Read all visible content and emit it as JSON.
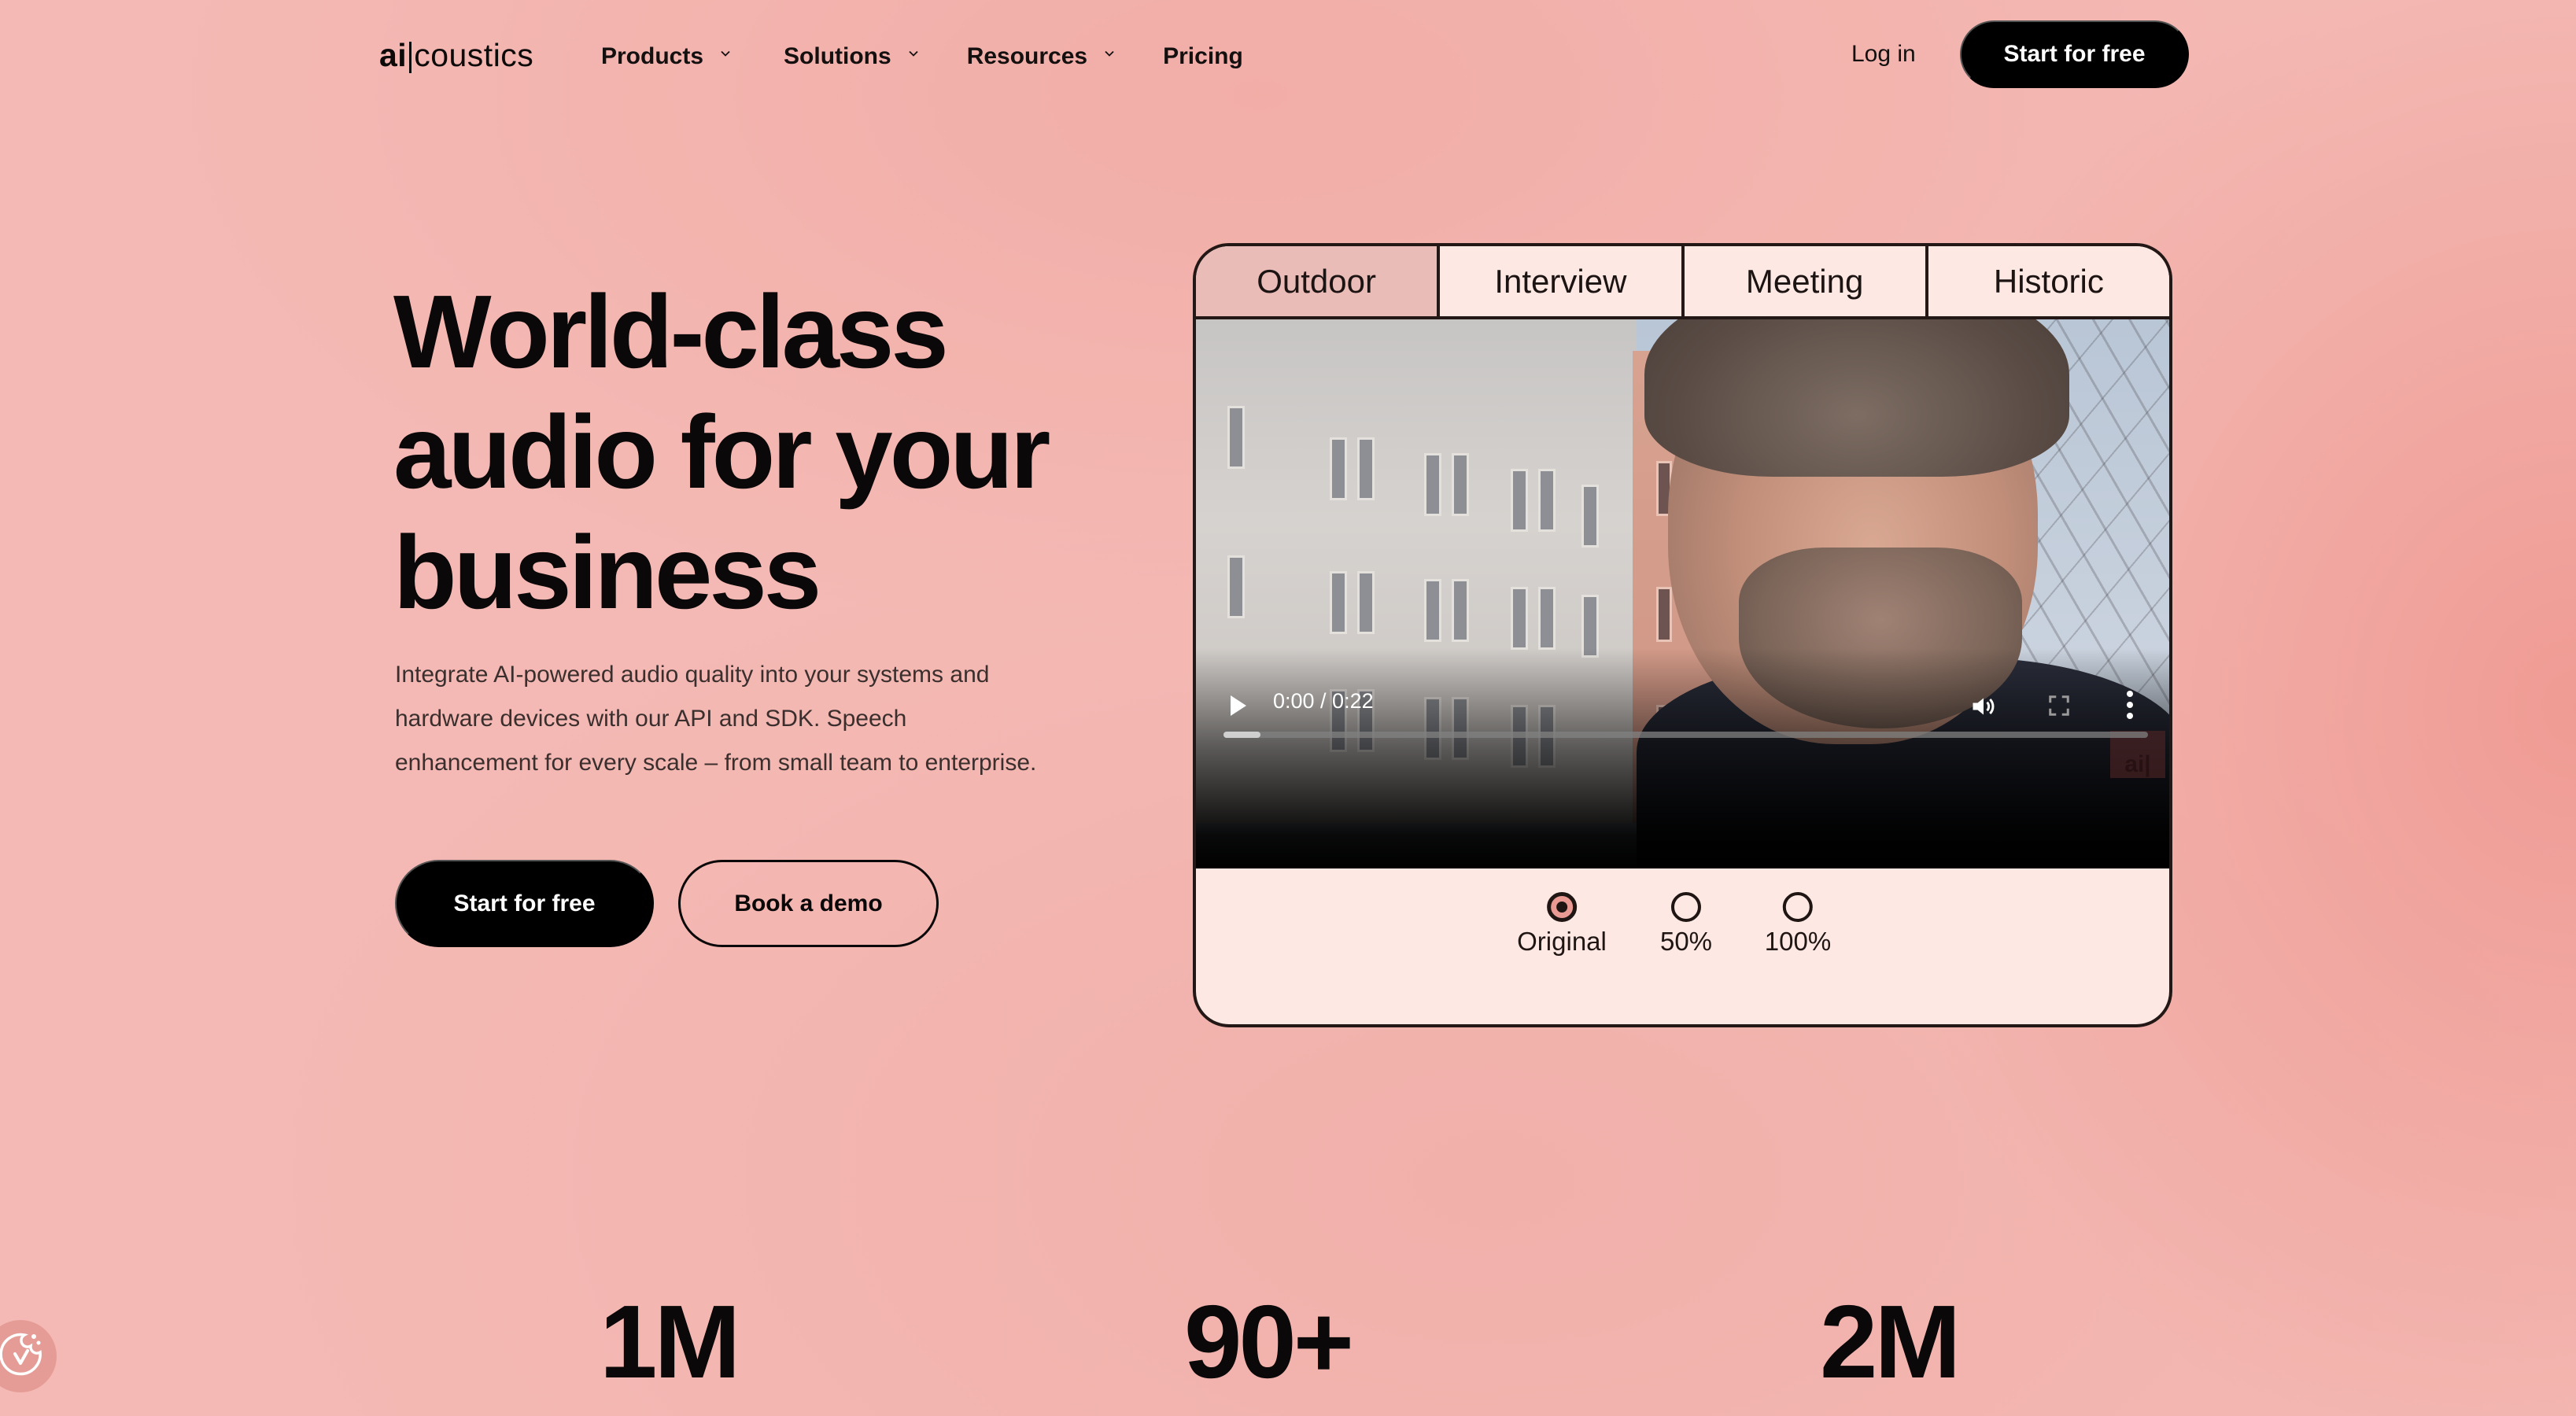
{
  "header": {
    "logo": {
      "bold": "ai",
      "rest": "coustics"
    },
    "nav": [
      {
        "label": "Products",
        "has_dropdown": true
      },
      {
        "label": "Solutions",
        "has_dropdown": true
      },
      {
        "label": "Resources",
        "has_dropdown": true
      },
      {
        "label": "Pricing",
        "has_dropdown": false
      }
    ],
    "login_label": "Log in",
    "cta_label": "Start for free"
  },
  "hero": {
    "title_lines": [
      "World-class",
      "audio for your",
      "business"
    ],
    "subtitle": "Integrate AI-powered audio quality into your systems and hardware devices with our API and SDK. Speech enhancement for every scale – from small team to enterprise.",
    "primary_cta": "Start for free",
    "secondary_cta": "Book a demo"
  },
  "demo": {
    "tabs": [
      {
        "label": "Outdoor",
        "active": true
      },
      {
        "label": "Interview",
        "active": false
      },
      {
        "label": "Meeting",
        "active": false
      },
      {
        "label": "Historic",
        "active": false
      }
    ],
    "video": {
      "time": "0:00 / 0:22",
      "buffered_fraction": 0.04,
      "watermark": "ai|",
      "icons": [
        "play-icon",
        "volume-icon",
        "fullscreen-icon",
        "more-options-icon"
      ]
    },
    "enhancement_options": [
      {
        "label": "Original",
        "checked": true
      },
      {
        "label": "50%",
        "checked": false
      },
      {
        "label": "100%",
        "checked": false
      }
    ]
  },
  "stats": [
    "1M",
    "90+",
    "2M"
  ],
  "colors": {
    "background": "#f4b9b4",
    "accent": "#e99a92",
    "card_bg": "#fde8e4",
    "active_tab": "#eabcb8",
    "border": "#231815",
    "button_dark": "#000000"
  }
}
